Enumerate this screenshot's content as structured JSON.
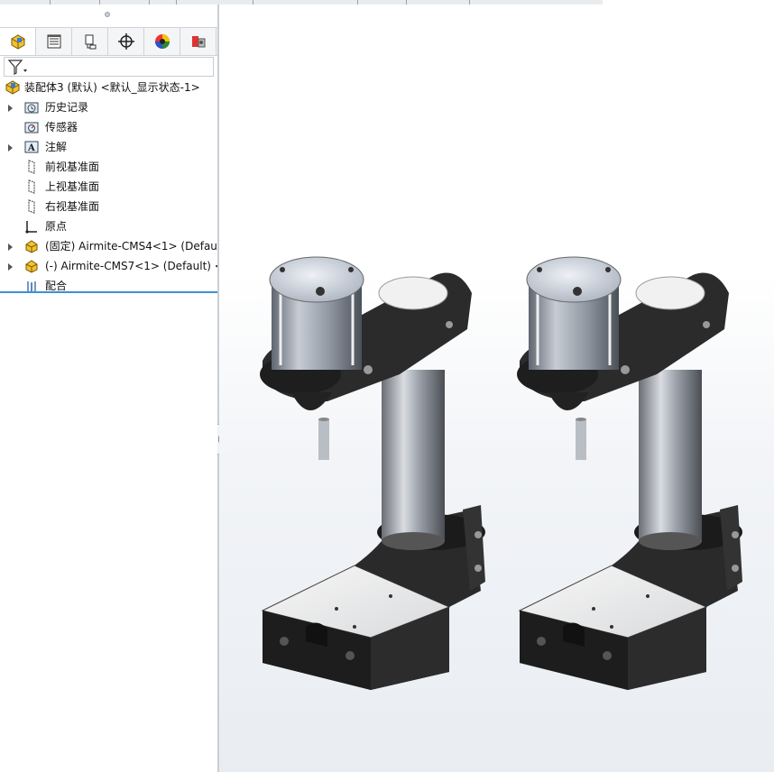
{
  "tabs": [
    {
      "icon": "feature-manager-icon",
      "active": true
    },
    {
      "icon": "property-manager-icon"
    },
    {
      "icon": "configuration-manager-icon"
    },
    {
      "icon": "dimxpert-icon"
    },
    {
      "icon": "display-manager-icon"
    },
    {
      "icon": "cam-manager-icon"
    }
  ],
  "filter": {
    "icon": "filter-icon"
  },
  "tree": {
    "root": "装配体3 (默认) <默认_显示状态-1>",
    "items": [
      {
        "label": "历史记录",
        "icon": "history-folder-icon",
        "expandable": true
      },
      {
        "label": "传感器",
        "icon": "sensor-folder-icon",
        "expandable": false
      },
      {
        "label": "注解",
        "icon": "annotation-folder-icon",
        "expandable": true
      },
      {
        "label": "前视基准面",
        "icon": "plane-icon",
        "expandable": false
      },
      {
        "label": "上视基准面",
        "icon": "plane-icon",
        "expandable": false
      },
      {
        "label": "右视基准面",
        "icon": "plane-icon",
        "expandable": false
      },
      {
        "label": "原点",
        "icon": "origin-icon",
        "expandable": false
      },
      {
        "label": "(固定) Airmite-CMS4<1> (Default",
        "icon": "assembly-part-icon",
        "expandable": true
      },
      {
        "label": "(-) Airmite-CMS7<1> (Default) <",
        "icon": "assembly-part-icon",
        "expandable": true
      },
      {
        "label": "配合",
        "icon": "mates-icon",
        "expandable": false
      }
    ]
  },
  "colors": {
    "accent": "#3d8fd6",
    "body_dark": "#2a2a2a",
    "steel": "#b8bfc8"
  }
}
